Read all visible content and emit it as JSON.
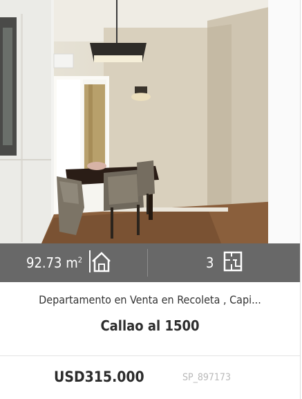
{
  "listing": {
    "area_value": "92.73 m",
    "area_unit_sup": "2",
    "rooms_value": "3",
    "title": "Departamento en Venta en Recoleta , Capi...",
    "address": "Callao al 1500",
    "price": "USD315.000",
    "code": "SP_897173"
  },
  "icons": {
    "area": "house-icon",
    "rooms": "floorplan-icon"
  },
  "colors": {
    "stats_bar": "#5c5c5c",
    "text_dark": "#2b2b2b",
    "code_gray": "#b9b9b9"
  }
}
